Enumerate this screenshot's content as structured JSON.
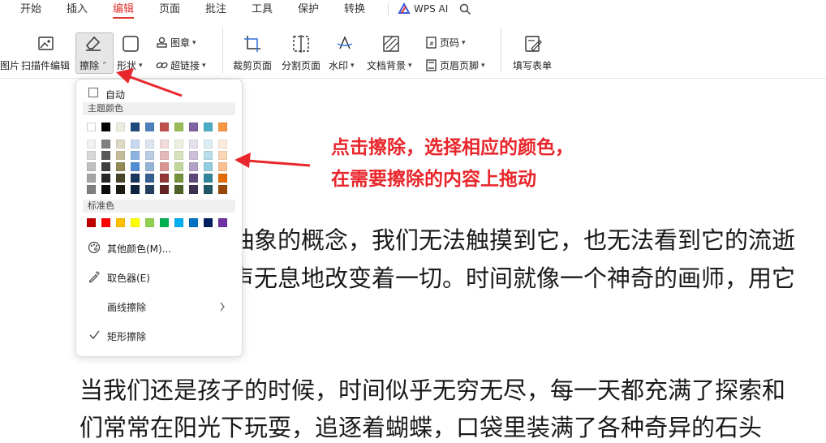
{
  "menubar": {
    "tabs": [
      {
        "label": "开始"
      },
      {
        "label": "插入"
      },
      {
        "label": "编辑"
      },
      {
        "label": "页面"
      },
      {
        "label": "批注"
      },
      {
        "label": "工具"
      },
      {
        "label": "保护"
      },
      {
        "label": "转换"
      }
    ],
    "active_tab": "编辑",
    "wps_ai_label": "WPS AI"
  },
  "ribbon": {
    "cut_label": "图片",
    "scan_edit_label": "扫描件编辑",
    "erase_label": "擦除",
    "shape_label": "形状",
    "stamp_label": "图章",
    "hyperlink_label": "超链接",
    "crop_page_label": "裁剪页面",
    "split_page_label": "分割页面",
    "watermark_label": "水印",
    "doc_bg_label": "文档背景",
    "page_num_label": "页码",
    "header_footer_label": "页眉页脚",
    "fill_form_label": "填写表单"
  },
  "erase_menu": {
    "auto_label": "自动",
    "theme_colors_label": "主题颜色",
    "standard_colors_label": "标准色",
    "more_colors_label": "其他颜色(M)...",
    "eyedropper_label": "取色器(E)",
    "line_erase_label": "画线擦除",
    "rect_erase_label": "矩形擦除",
    "theme_top_row": [
      "#ffffff",
      "#000000",
      "#eeece1",
      "#1f497d",
      "#4f81bd",
      "#c0504d",
      "#9bbb59",
      "#8064a2",
      "#4bacc6",
      "#f79646"
    ],
    "theme_shades": [
      [
        "#f2f2f2",
        "#7f7f7f",
        "#ddd9c3",
        "#c6d9f0",
        "#dbe5f1",
        "#f2dcdb",
        "#ebf1dd",
        "#e5e0ec",
        "#dbeef3",
        "#fdeada"
      ],
      [
        "#d8d8d8",
        "#595959",
        "#c4bd97",
        "#8db3e2",
        "#b8cce4",
        "#e5b9b7",
        "#d7e3bc",
        "#ccc1d9",
        "#b7dde8",
        "#fbd5b5"
      ],
      [
        "#bfbfbf",
        "#3f3f3f",
        "#938953",
        "#548dd4",
        "#95b3d7",
        "#d99694",
        "#c3d69b",
        "#b2a2c7",
        "#92cddc",
        "#fac08f"
      ],
      [
        "#a5a5a5",
        "#262626",
        "#494429",
        "#17365d",
        "#366092",
        "#953734",
        "#76923c",
        "#5f497a",
        "#31859b",
        "#e36c09"
      ],
      [
        "#7f7f7f",
        "#0c0c0c",
        "#1d1b10",
        "#0f243e",
        "#244061",
        "#632423",
        "#4f6128",
        "#3f3151",
        "#205867",
        "#974806"
      ]
    ],
    "standard_colors": [
      "#c00000",
      "#ff0000",
      "#ffc000",
      "#ffff00",
      "#92d050",
      "#00b050",
      "#00b0f0",
      "#0070c0",
      "#002060",
      "#7030a0"
    ]
  },
  "annotation": {
    "line1": "点击擦除，选择相应的颜色，",
    "line2": "在需要擦除的内容上拖动",
    "color": "#e8262b"
  },
  "document": {
    "line1": "抽象的概念，我们无法触摸到它，也无法看到它的流逝",
    "line2": "声无息地改变着一切。时间就像一个神奇的画师，用它",
    "line3": "当我们还是孩子的时候，时间似乎无穷无尽，每一天都充满了探索和",
    "line4": "们常常在阳光下玩耍，追逐着蝴蝶，口袋里装满了各种奇异的石头"
  }
}
